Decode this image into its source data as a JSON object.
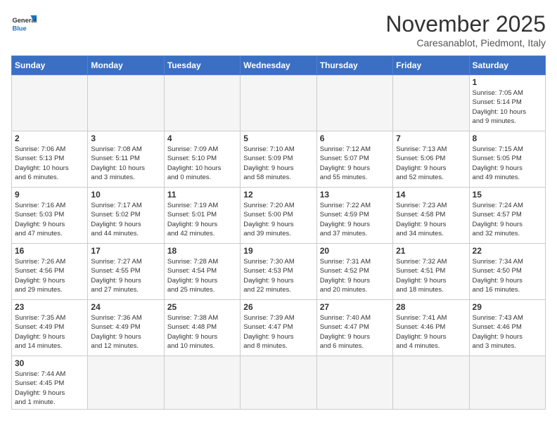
{
  "header": {
    "logo_general": "General",
    "logo_blue": "Blue",
    "month": "November 2025",
    "location": "Caresanablot, Piedmont, Italy"
  },
  "days_of_week": [
    "Sunday",
    "Monday",
    "Tuesday",
    "Wednesday",
    "Thursday",
    "Friday",
    "Saturday"
  ],
  "weeks": [
    [
      {
        "day": "",
        "info": ""
      },
      {
        "day": "",
        "info": ""
      },
      {
        "day": "",
        "info": ""
      },
      {
        "day": "",
        "info": ""
      },
      {
        "day": "",
        "info": ""
      },
      {
        "day": "",
        "info": ""
      },
      {
        "day": "1",
        "info": "Sunrise: 7:05 AM\nSunset: 5:14 PM\nDaylight: 10 hours\nand 9 minutes."
      }
    ],
    [
      {
        "day": "2",
        "info": "Sunrise: 7:06 AM\nSunset: 5:13 PM\nDaylight: 10 hours\nand 6 minutes."
      },
      {
        "day": "3",
        "info": "Sunrise: 7:08 AM\nSunset: 5:11 PM\nDaylight: 10 hours\nand 3 minutes."
      },
      {
        "day": "4",
        "info": "Sunrise: 7:09 AM\nSunset: 5:10 PM\nDaylight: 10 hours\nand 0 minutes."
      },
      {
        "day": "5",
        "info": "Sunrise: 7:10 AM\nSunset: 5:09 PM\nDaylight: 9 hours\nand 58 minutes."
      },
      {
        "day": "6",
        "info": "Sunrise: 7:12 AM\nSunset: 5:07 PM\nDaylight: 9 hours\nand 55 minutes."
      },
      {
        "day": "7",
        "info": "Sunrise: 7:13 AM\nSunset: 5:06 PM\nDaylight: 9 hours\nand 52 minutes."
      },
      {
        "day": "8",
        "info": "Sunrise: 7:15 AM\nSunset: 5:05 PM\nDaylight: 9 hours\nand 49 minutes."
      }
    ],
    [
      {
        "day": "9",
        "info": "Sunrise: 7:16 AM\nSunset: 5:03 PM\nDaylight: 9 hours\nand 47 minutes."
      },
      {
        "day": "10",
        "info": "Sunrise: 7:17 AM\nSunset: 5:02 PM\nDaylight: 9 hours\nand 44 minutes."
      },
      {
        "day": "11",
        "info": "Sunrise: 7:19 AM\nSunset: 5:01 PM\nDaylight: 9 hours\nand 42 minutes."
      },
      {
        "day": "12",
        "info": "Sunrise: 7:20 AM\nSunset: 5:00 PM\nDaylight: 9 hours\nand 39 minutes."
      },
      {
        "day": "13",
        "info": "Sunrise: 7:22 AM\nSunset: 4:59 PM\nDaylight: 9 hours\nand 37 minutes."
      },
      {
        "day": "14",
        "info": "Sunrise: 7:23 AM\nSunset: 4:58 PM\nDaylight: 9 hours\nand 34 minutes."
      },
      {
        "day": "15",
        "info": "Sunrise: 7:24 AM\nSunset: 4:57 PM\nDaylight: 9 hours\nand 32 minutes."
      }
    ],
    [
      {
        "day": "16",
        "info": "Sunrise: 7:26 AM\nSunset: 4:56 PM\nDaylight: 9 hours\nand 29 minutes."
      },
      {
        "day": "17",
        "info": "Sunrise: 7:27 AM\nSunset: 4:55 PM\nDaylight: 9 hours\nand 27 minutes."
      },
      {
        "day": "18",
        "info": "Sunrise: 7:28 AM\nSunset: 4:54 PM\nDaylight: 9 hours\nand 25 minutes."
      },
      {
        "day": "19",
        "info": "Sunrise: 7:30 AM\nSunset: 4:53 PM\nDaylight: 9 hours\nand 22 minutes."
      },
      {
        "day": "20",
        "info": "Sunrise: 7:31 AM\nSunset: 4:52 PM\nDaylight: 9 hours\nand 20 minutes."
      },
      {
        "day": "21",
        "info": "Sunrise: 7:32 AM\nSunset: 4:51 PM\nDaylight: 9 hours\nand 18 minutes."
      },
      {
        "day": "22",
        "info": "Sunrise: 7:34 AM\nSunset: 4:50 PM\nDaylight: 9 hours\nand 16 minutes."
      }
    ],
    [
      {
        "day": "23",
        "info": "Sunrise: 7:35 AM\nSunset: 4:49 PM\nDaylight: 9 hours\nand 14 minutes."
      },
      {
        "day": "24",
        "info": "Sunrise: 7:36 AM\nSunset: 4:49 PM\nDaylight: 9 hours\nand 12 minutes."
      },
      {
        "day": "25",
        "info": "Sunrise: 7:38 AM\nSunset: 4:48 PM\nDaylight: 9 hours\nand 10 minutes."
      },
      {
        "day": "26",
        "info": "Sunrise: 7:39 AM\nSunset: 4:47 PM\nDaylight: 9 hours\nand 8 minutes."
      },
      {
        "day": "27",
        "info": "Sunrise: 7:40 AM\nSunset: 4:47 PM\nDaylight: 9 hours\nand 6 minutes."
      },
      {
        "day": "28",
        "info": "Sunrise: 7:41 AM\nSunset: 4:46 PM\nDaylight: 9 hours\nand 4 minutes."
      },
      {
        "day": "29",
        "info": "Sunrise: 7:43 AM\nSunset: 4:46 PM\nDaylight: 9 hours\nand 3 minutes."
      }
    ],
    [
      {
        "day": "30",
        "info": "Sunrise: 7:44 AM\nSunset: 4:45 PM\nDaylight: 9 hours\nand 1 minute."
      },
      {
        "day": "",
        "info": ""
      },
      {
        "day": "",
        "info": ""
      },
      {
        "day": "",
        "info": ""
      },
      {
        "day": "",
        "info": ""
      },
      {
        "day": "",
        "info": ""
      },
      {
        "day": "",
        "info": ""
      }
    ]
  ]
}
